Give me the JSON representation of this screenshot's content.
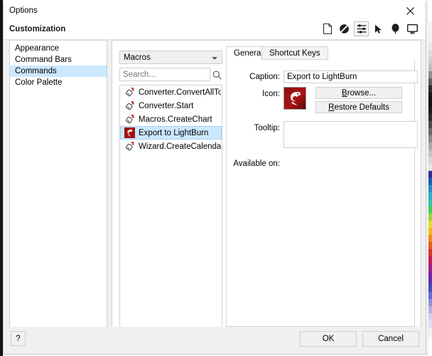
{
  "window": {
    "title": "Options",
    "close_label": "×"
  },
  "header": {
    "section_title": "Customization",
    "toolbar": [
      {
        "name": "page-icon",
        "label": "Page"
      },
      {
        "name": "ban-icon",
        "label": "No Symbol"
      },
      {
        "name": "sliders-icon",
        "label": "Customization",
        "active": true
      },
      {
        "name": "cursor-arrow-icon",
        "label": "Select"
      },
      {
        "name": "balloon-pin-icon",
        "label": "Pin"
      },
      {
        "name": "monitor-icon",
        "label": "Display"
      }
    ]
  },
  "sidebar": {
    "items": [
      {
        "label": "Appearance",
        "selected": false
      },
      {
        "label": "Command Bars",
        "selected": false
      },
      {
        "label": "Commands",
        "selected": true
      },
      {
        "label": "Color Palette",
        "selected": false
      }
    ]
  },
  "middle": {
    "category_dropdown": {
      "value": "Macros",
      "options": [
        "Macros"
      ]
    },
    "search": {
      "value": "",
      "placeholder": "Search...",
      "icon": "search-icon"
    },
    "list": [
      {
        "label": "Converter.ConvertAllToCur...",
        "icon": "macro-icon",
        "selected": false
      },
      {
        "label": "Converter.Start",
        "icon": "macro-icon",
        "selected": false
      },
      {
        "label": "Macros.CreateChart",
        "icon": "macro-icon",
        "selected": false
      },
      {
        "label": "Export to LightBurn",
        "icon": "lightburn-icon",
        "selected": true
      },
      {
        "label": "Wizard.CreateCalendar",
        "icon": "macro-icon",
        "selected": false
      }
    ]
  },
  "details": {
    "tabs": [
      {
        "label": "General",
        "active": true
      },
      {
        "label": "Shortcut Keys",
        "active": false
      }
    ],
    "caption_label": "Caption:",
    "caption_value": "Export to LightBurn",
    "icon_label": "Icon:",
    "browse_button": {
      "prefix": "",
      "accel": "B",
      "suffix": "rowse..."
    },
    "restore_button": {
      "prefix": "",
      "accel": "R",
      "suffix": "estore Defaults"
    },
    "tooltip_label": "Tooltip:",
    "tooltip_value": "",
    "available_on_label": "Available on:"
  },
  "footer": {
    "help_label": "?",
    "ok_label": "OK",
    "cancel_label": "Cancel"
  },
  "colors": {
    "selection_blue": "#cce8ff",
    "selection_border": "#a5d2f5",
    "icon_red_dark": "#7d0d0d",
    "icon_red": "#b51515",
    "panel_bg": "#f0f0f0",
    "border_gray": "#d2d2d2"
  },
  "background_strip_colors": [
    "#ffffff",
    "#ffffff",
    "#ffffff",
    "#f3f3f3",
    "#f3f3f3",
    "#f3f3f3",
    "#e9e9e9",
    "#dddddd",
    "#cfcfcf",
    "#bdbdbd",
    "#8f8f8f",
    "#5e5e5e",
    "#2b2b2b",
    "#151515",
    "#101010",
    "#1c1c1c",
    "#2e2e2e",
    "#4a4a4a",
    "#6a6a6a",
    "#8a8a8a",
    "#a8a8a8",
    "#c2c2c2",
    "#d6d6d6",
    "#e4e4e4",
    "#2f2f8f",
    "#1c5fb0",
    "#1f8ec9",
    "#27b0c9",
    "#2fc4a0",
    "#49c95c",
    "#9ed43a",
    "#e2dc2e",
    "#f0b81e",
    "#ee8a1c",
    "#e85a1c",
    "#d93030",
    "#c41f5a",
    "#a41f82",
    "#7d25a0",
    "#5a2eb0",
    "#4a4ac0",
    "#6a6ad0",
    "#8f8fd8",
    "#b0b0e2",
    "#cfcfee",
    "#e0e0f4",
    "#eeeef8",
    "#f8f8fc",
    "#ffffff",
    "#ffffff"
  ]
}
